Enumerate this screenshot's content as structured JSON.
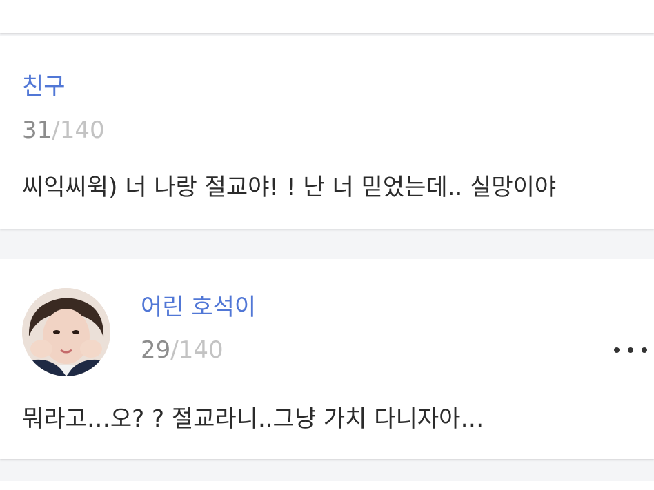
{
  "posts": [
    {
      "author": "친구",
      "char_count": "31",
      "char_max": "/140",
      "message": "씨익씨윅) 너 나랑 절교야! ! 난 너 믿었는데.. 실망이야"
    },
    {
      "author": "어린 호석이",
      "char_count": "29",
      "char_max": "/140",
      "message": "뭐라고…오? ?  절교라니..그냥 가치 다니자아…",
      "avatar_icon": "profile-photo",
      "more_icon": "more-dots-icon"
    }
  ],
  "colors": {
    "author": "#5177d6",
    "count_current": "#8d8d8d",
    "count_max": "#c3c3c3",
    "message": "#2b2b2b",
    "background": "#f4f5f7"
  }
}
